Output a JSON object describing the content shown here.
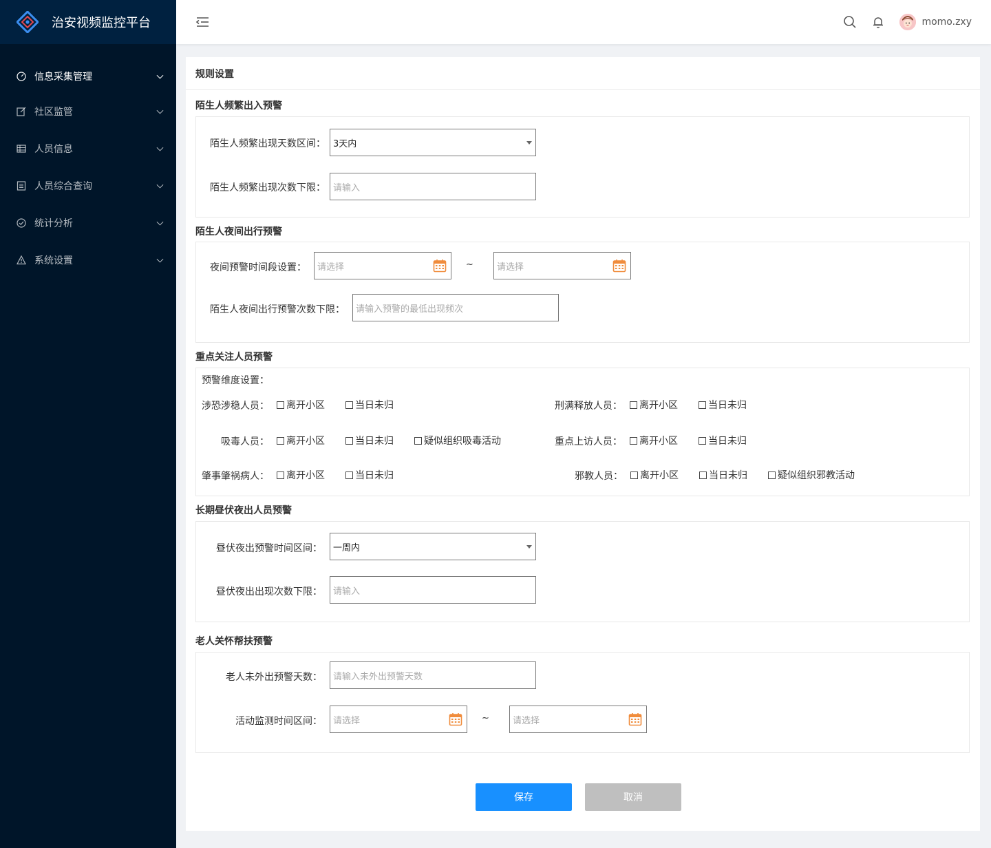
{
  "app": {
    "title": "治安视频监控平台"
  },
  "sidebar": {
    "items": [
      {
        "label": "信息采集管理",
        "icon": "dashboard-icon",
        "active": true
      },
      {
        "label": "社区监管",
        "icon": "edit-icon"
      },
      {
        "label": "人员信息",
        "icon": "table-icon"
      },
      {
        "label": "人员综合查询",
        "icon": "profile-icon"
      },
      {
        "label": "统计分析",
        "icon": "check-circle-icon"
      },
      {
        "label": "系统设置",
        "icon": "warning-icon"
      }
    ]
  },
  "header": {
    "username": "momo.zxy"
  },
  "page": {
    "title": "规则设置"
  },
  "sections": {
    "stranger_freq": {
      "title": "陌生人频繁出入预警",
      "days_label": "陌生人频繁出现天数区间：",
      "days_value": "3天内",
      "count_label": "陌生人频繁出现次数下限：",
      "count_placeholder": "请输入"
    },
    "stranger_night": {
      "title": "陌生人夜间出行预警",
      "period_label": "夜间预警时间段设置：",
      "start_placeholder": "请选择",
      "end_placeholder": "请选择",
      "tilde": "~",
      "count_label": "陌生人夜间出行预警次数下限：",
      "count_placeholder": "请输入预警的最低出现频次"
    },
    "key_persons": {
      "title": "重点关注人员预警",
      "dim_label": "预警维度设置：",
      "rows": {
        "terror": {
          "label": "涉恐涉稳人员：",
          "opts": [
            "离开小区",
            "当日未归"
          ]
        },
        "released": {
          "label": "刑满释放人员：",
          "opts": [
            "离开小区",
            "当日未归"
          ]
        },
        "drug": {
          "label": "吸毒人员：",
          "opts": [
            "离开小区",
            "当日未归",
            "疑似组织吸毒活动"
          ]
        },
        "petition": {
          "label": "重点上访人员：",
          "opts": [
            "离开小区",
            "当日未归"
          ]
        },
        "mental": {
          "label": "肇事肇祸病人：",
          "opts": [
            "离开小区",
            "当日未归"
          ]
        },
        "cult": {
          "label": "邪教人员：",
          "opts": [
            "离开小区",
            "当日未归",
            "疑似组织邪教活动"
          ]
        }
      }
    },
    "night_owl": {
      "title": "长期昼伏夜出人员预警",
      "period_label": "昼伏夜出预警时间区间：",
      "period_value": "一周内",
      "count_label": "昼伏夜出出现次数下限：",
      "count_placeholder": "请输入"
    },
    "elderly": {
      "title": "老人关怀帮扶预警",
      "days_label": "老人未外出预警天数：",
      "days_placeholder": "请输入未外出预警天数",
      "range_label": "活动监测时间区间：",
      "start_placeholder": "请选择",
      "end_placeholder": "请选择",
      "tilde": "~"
    }
  },
  "actions": {
    "save": "保存",
    "cancel": "取消"
  },
  "colors": {
    "sidebar": "#001529",
    "brand_bar": "#002140",
    "primary": "#1890ff",
    "calendar": "#f08c3c"
  }
}
